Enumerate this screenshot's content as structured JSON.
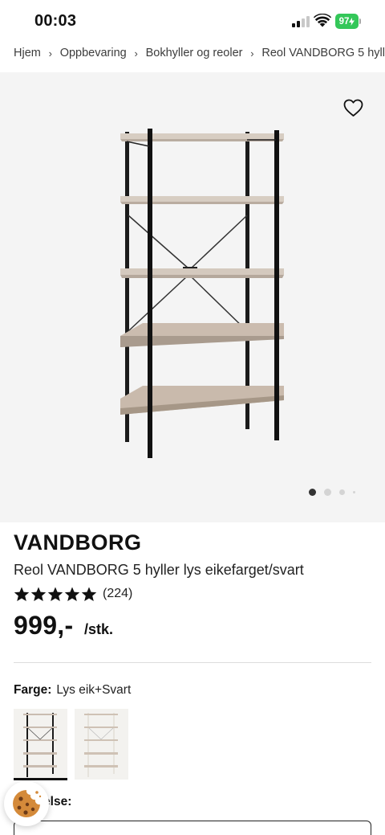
{
  "status_bar": {
    "time": "00:03",
    "battery": "97"
  },
  "breadcrumb": {
    "items": [
      "Hjem",
      "Oppbevaring",
      "Bokhyller og reoler",
      "Reol VANDBORG 5 hyll"
    ]
  },
  "gallery": {
    "image_count": 4,
    "active_index": 0,
    "favorite_icon": "heart-outline-icon"
  },
  "product": {
    "brand": "VANDBORG",
    "name": "Reol VANDBORG 5 hyller lys eikefarget/svart",
    "rating": 5,
    "review_count": "(224)",
    "price": "999,-",
    "unit": "/stk."
  },
  "color": {
    "label": "Farge:",
    "value": "Lys eik+Svart",
    "options": [
      "black-frame",
      "white-frame"
    ]
  },
  "size": {
    "label": "Størrelse:",
    "label_visible": "else:"
  },
  "colors": {
    "battery": "#34c759",
    "gallery_bg": "#f4f4f4",
    "frame": "#1b1b1b",
    "shelf": "#c9bcb0"
  }
}
